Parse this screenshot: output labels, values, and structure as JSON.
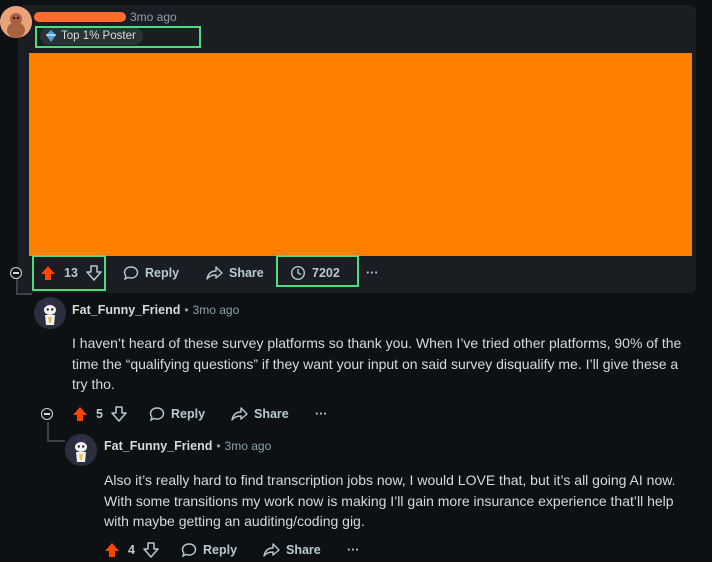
{
  "post": {
    "time": "3mo ago",
    "flair": "Top 1% Poster",
    "media_color": "#ff8000",
    "votes": "13",
    "reply_label": "Reply",
    "share_label": "Share",
    "views": "7202",
    "more": "···"
  },
  "comments": [
    {
      "username": "Fat_Funny_Friend",
      "time": "3mo ago",
      "lines": [
        "I haven’t heard of these survey platforms so thank you. When I’ve tried other platforms, 90% of the",
        "time the “qualifying questions” if they want your input on said survey disqualify me. I’ll give these a",
        "try tho."
      ],
      "votes": "5",
      "reply_label": "Reply",
      "share_label": "Share",
      "more": "···"
    },
    {
      "username": "Fat_Funny_Friend",
      "time": "3mo ago",
      "lines": [
        "Also it’s really hard to find transcription jobs now, I would LOVE that, but it’s all going AI now.",
        "With some transitions my work now is making I’ll gain more insurance experience that’ll help",
        "with maybe getting an auditing/coding gig."
      ],
      "votes": "4",
      "reply_label": "Reply",
      "share_label": "Share",
      "more": "···"
    }
  ],
  "colors": {
    "upvote": "#ff4500",
    "highlight": "#4ade80",
    "background": "#0e1113"
  },
  "icons": [
    "avatar",
    "upvote-icon",
    "downvote-icon",
    "comment-icon",
    "share-icon",
    "views-icon",
    "collapse-icon"
  ]
}
